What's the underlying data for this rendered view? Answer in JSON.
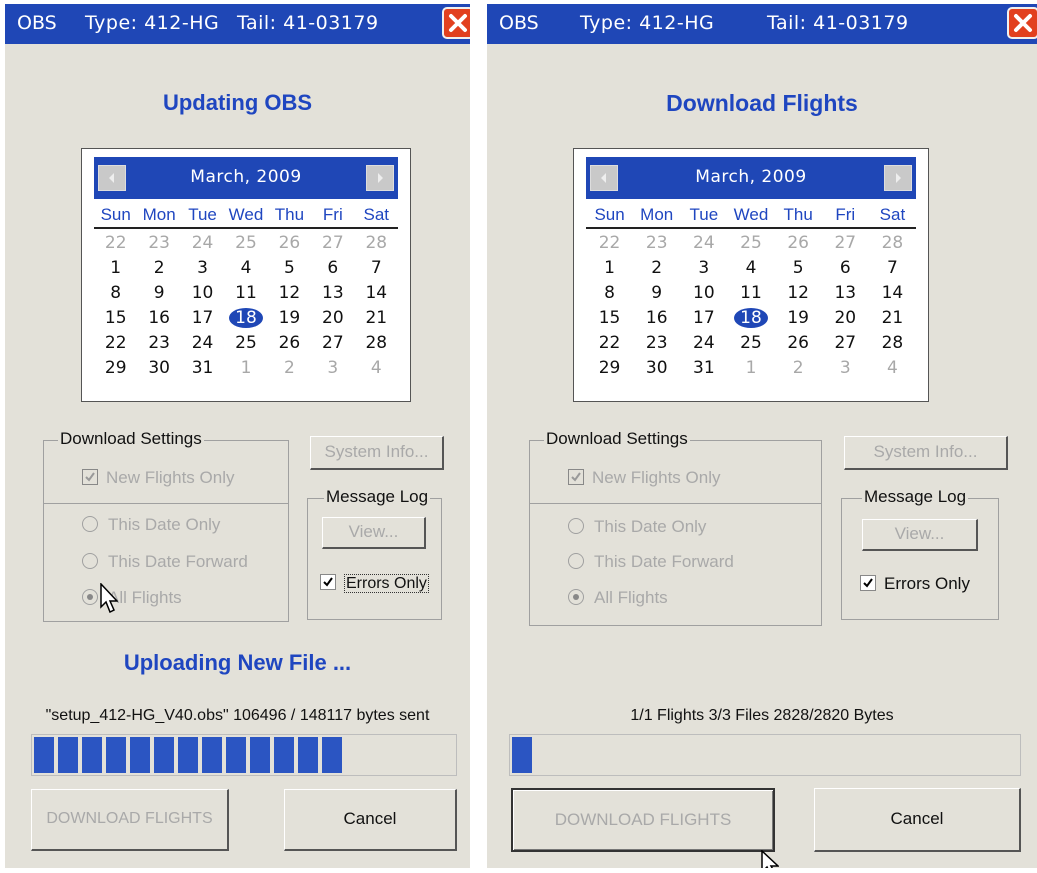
{
  "window": {
    "app": "OBS",
    "type": "Type: 412-HG",
    "tail": "Tail: 41-03179"
  },
  "calendar": {
    "month": "March, 2009",
    "weekdays": [
      "Sun",
      "Mon",
      "Tue",
      "Wed",
      "Thu",
      "Fri",
      "Sat"
    ],
    "weeks": [
      [
        "22",
        "23",
        "24",
        "25",
        "26",
        "27",
        "28"
      ],
      [
        "1",
        "2",
        "3",
        "4",
        "5",
        "6",
        "7"
      ],
      [
        "8",
        "9",
        "10",
        "11",
        "12",
        "13",
        "14"
      ],
      [
        "15",
        "16",
        "17",
        "18",
        "19",
        "20",
        "21"
      ],
      [
        "22",
        "23",
        "24",
        "25",
        "26",
        "27",
        "28"
      ],
      [
        "29",
        "30",
        "31",
        "1",
        "2",
        "3",
        "4"
      ]
    ],
    "selected_day": "18"
  },
  "settings": {
    "group_title": "Download Settings",
    "new_flights_only": "New Flights Only",
    "this_date_only": "This Date Only",
    "this_date_forward": "This Date Forward",
    "all_flights": "All Flights",
    "system_info": "System Info...",
    "message_log": "Message Log",
    "view": "View...",
    "errors_only": "Errors Only"
  },
  "buttons": {
    "download_flights": "DOWNLOAD FLIGHTS",
    "cancel": "Cancel"
  },
  "left_panel": {
    "heading": "Updating OBS",
    "status": "Uploading New File ...",
    "detail": "\"setup_412-HG_V40.obs\"  106496 / 148117 bytes sent",
    "progress_fraction": 0.72
  },
  "right_panel": {
    "heading": "Download Flights",
    "detail": "1/1 Flights  3/3 Files  2828/2820 Bytes",
    "progress_fraction": 0.05
  },
  "colors": {
    "title_bar": "#1f47b6",
    "heading_text": "#1f46c0",
    "progress_block": "#2b55c2",
    "dialog_bg": "#e3e1d9"
  }
}
